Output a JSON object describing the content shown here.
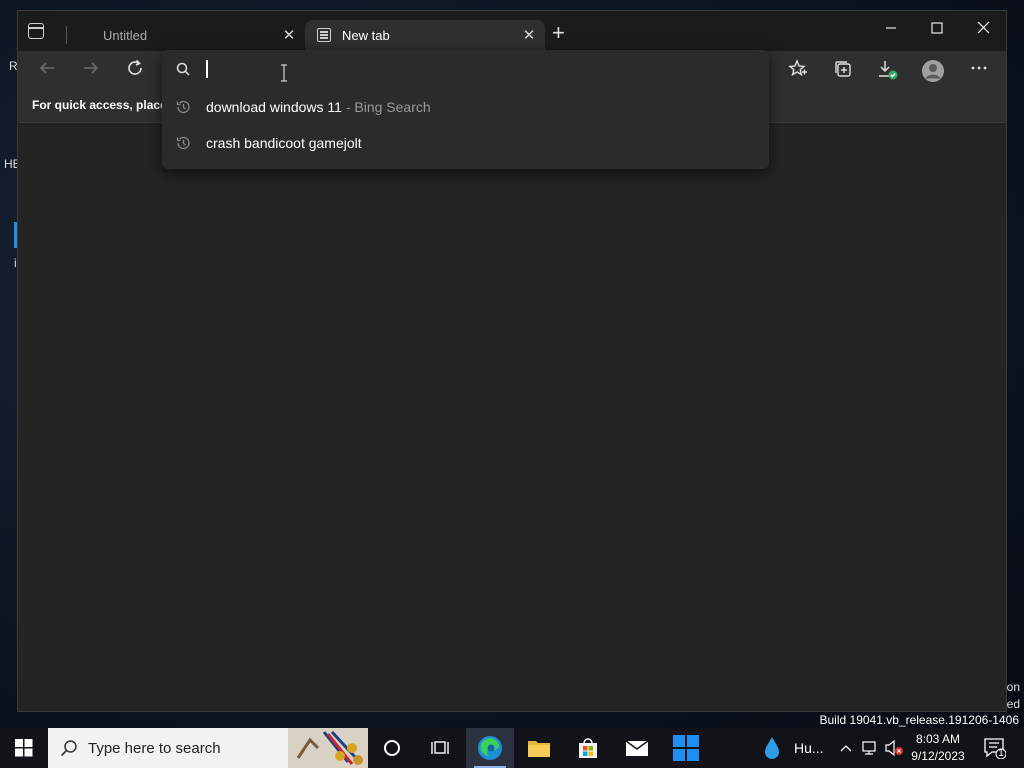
{
  "desktop": {
    "peek_r": "R",
    "peek_he": "HE",
    "peek_i": "i",
    "watermark_build": "Build 19041.vb_release.191206-1406",
    "watermark_frag1": "on",
    "watermark_frag2": "ed"
  },
  "browser": {
    "tabs": [
      {
        "label": "Untitled",
        "active": false,
        "close_glyph": "✕"
      },
      {
        "label": "New tab",
        "active": true,
        "close_glyph": "✕"
      }
    ],
    "new_tab_glyph": "+",
    "window_controls": {
      "minimize": "—",
      "maximize": "☐",
      "close": "✕"
    },
    "favbar_message": "For quick access, place y",
    "address": {
      "value": "",
      "suggestions": [
        {
          "text": "download windows 11",
          "suffix": " - Bing Search",
          "icon": "history-icon"
        },
        {
          "text": "crash bandicoot gamejolt",
          "suffix": "",
          "icon": "history-icon"
        }
      ]
    },
    "toolbar_icons": [
      "back-icon",
      "forward-icon",
      "refresh-icon",
      "favorites-icon",
      "collections-icon",
      "downloads-icon",
      "profile-icon",
      "more-icon"
    ],
    "colors": {
      "titlebar": "#1b1b1b",
      "toolbar": "#2f2f2f",
      "content": "#242424",
      "dropdown": "#2b2b2b"
    }
  },
  "taskbar": {
    "search_placeholder": "Type here to search",
    "apps": [
      "cortana-icon",
      "task-view-icon",
      "edge-icon",
      "file-explorer-icon",
      "store-icon",
      "mail-icon",
      "windows-app-icon"
    ],
    "weather_text": "Hu...",
    "clock_time": "8:03 AM",
    "clock_date": "9/12/2023",
    "notification_count": "1"
  }
}
